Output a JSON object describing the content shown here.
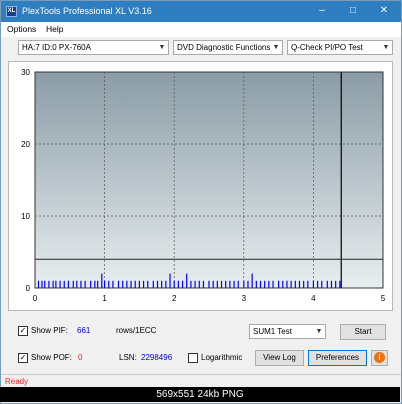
{
  "window": {
    "title": "PlexTools Professional XL V3.16",
    "icon_label": "XL",
    "minimize_icon": "minimize-icon",
    "maximize_icon": "maximize-icon",
    "close_icon": "close-icon",
    "titlebar_color": "#2d7fc1"
  },
  "menu": {
    "options": "Options",
    "help": "Help"
  },
  "toolbar": {
    "drive": "HA:7 ID:0  PX-760A",
    "function": "DVD Diagnostic Functions",
    "test": "Q-Check PI/PO Test"
  },
  "chart_data": {
    "type": "bar",
    "x_ticks": [
      "0",
      "1",
      "2",
      "3",
      "4",
      "5"
    ],
    "y_ticks": [
      "0",
      "10",
      "20",
      "30"
    ],
    "xlim": [
      0,
      5
    ],
    "ylim": [
      0,
      30
    ],
    "threshold": 4,
    "disc_end_x": 4.4,
    "series": [
      {
        "color": "#0000ff",
        "x": [
          0.05,
          0.1,
          0.14,
          0.2,
          0.26,
          0.3,
          0.36,
          0.42,
          0.48,
          0.55,
          0.6,
          0.66,
          0.72,
          0.8,
          0.86,
          0.9,
          0.96,
          1.0,
          1.06,
          1.12,
          1.2,
          1.26,
          1.32,
          1.38,
          1.44,
          1.5,
          1.56,
          1.62,
          1.7,
          1.76,
          1.82,
          1.88,
          1.94,
          2.0,
          2.06,
          2.12,
          2.18,
          2.24,
          2.3,
          2.36,
          2.42,
          2.5,
          2.56,
          2.62,
          2.68,
          2.74,
          2.8,
          2.86,
          2.92,
          3.0,
          3.06,
          3.12,
          3.18,
          3.24,
          3.3,
          3.36,
          3.42,
          3.5,
          3.56,
          3.62,
          3.68,
          3.74,
          3.8,
          3.86,
          3.92,
          4.0,
          4.06,
          4.12,
          4.2,
          4.26,
          4.32,
          4.38
        ],
        "values": [
          1,
          1,
          1,
          1,
          1,
          1,
          1,
          1,
          1,
          1,
          1,
          1,
          1,
          1,
          1,
          1,
          2,
          1,
          1,
          1,
          1,
          1,
          1,
          1,
          1,
          1,
          1,
          1,
          1,
          1,
          1,
          1,
          2,
          1,
          1,
          1,
          2,
          1,
          1,
          1,
          1,
          1,
          1,
          1,
          1,
          1,
          1,
          1,
          1,
          1,
          1,
          2,
          1,
          1,
          1,
          1,
          1,
          1,
          1,
          1,
          1,
          1,
          1,
          1,
          1,
          1,
          1,
          1,
          1,
          1,
          1,
          1
        ]
      }
    ],
    "grid": true,
    "background_gradient": [
      "#8a9ca6",
      "#e8eef0"
    ]
  },
  "stats": {
    "pif_label": "Show PIF:",
    "pif_value": "661",
    "pif_unit": "rows/1ECC",
    "pof_label": "Show POF:",
    "pof_value": "0",
    "lsn_label": "LSN:",
    "lsn_value": "2298496",
    "log_label": "Logarithmic"
  },
  "controls": {
    "sum_select": "SUM1 Test",
    "start": "Start",
    "view_log": "View Log",
    "preferences": "Preferences",
    "info_icon": "info-icon"
  },
  "status": {
    "text": "Ready"
  },
  "caption": {
    "text": "569x551  24kb  PNG"
  }
}
